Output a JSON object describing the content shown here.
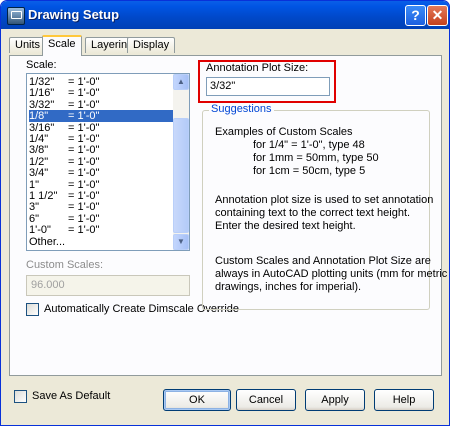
{
  "window": {
    "title": "Drawing Setup",
    "help_glyph": "?",
    "close_glyph": "✕"
  },
  "tabs": [
    "Units",
    "Scale",
    "Layering",
    "Display"
  ],
  "scale": {
    "label": "Scale:",
    "items": [
      {
        "k": "1/32\"",
        "v": "= 1'-0\""
      },
      {
        "k": "1/16\"",
        "v": "= 1'-0\""
      },
      {
        "k": "3/32\"",
        "v": "= 1'-0\""
      },
      {
        "k": "1/8\"",
        "v": "= 1'-0\"",
        "selected": true
      },
      {
        "k": "3/16\"",
        "v": "= 1'-0\""
      },
      {
        "k": "1/4\"",
        "v": "= 1'-0\""
      },
      {
        "k": "3/8\"",
        "v": "= 1'-0\""
      },
      {
        "k": "1/2\"",
        "v": "= 1'-0\""
      },
      {
        "k": "3/4\"",
        "v": "= 1'-0\""
      },
      {
        "k": "1\"",
        "v": "= 1'-0\""
      },
      {
        "k": "1 1/2\"",
        "v": "= 1'-0\""
      },
      {
        "k": "3\"",
        "v": "= 1'-0\""
      },
      {
        "k": "6\"",
        "v": "= 1'-0\""
      },
      {
        "k": "1'-0\"",
        "v": "= 1'-0\""
      },
      {
        "k": "Other...",
        "v": ""
      }
    ]
  },
  "custom_scales": {
    "label": "Custom Scales:",
    "value": "96.000"
  },
  "dimscale_checkbox": {
    "label": "Automatically Create Dimscale Override"
  },
  "annotation": {
    "label": "Annotation Plot Size:",
    "value": "3/32\""
  },
  "suggestions": {
    "title": "Suggestions",
    "examples_heading": "Examples of Custom Scales",
    "examples": [
      "for 1/4\" = 1'-0\", type 48",
      "for 1mm = 50mm, type 50",
      "for 1cm = 50cm, type 5"
    ],
    "para1": [
      "Annotation plot size is used to set annotation",
      "containing text to the correct text height.",
      "Enter the desired text height."
    ],
    "para2": [
      "Custom Scales and Annotation Plot Size are",
      "always in AutoCAD plotting units (mm for metric",
      "drawings, inches for imperial)."
    ]
  },
  "save_default": {
    "label": "Save As Default"
  },
  "buttons": {
    "ok": "OK",
    "cancel": "Cancel",
    "apply": "Apply",
    "help": "Help"
  }
}
